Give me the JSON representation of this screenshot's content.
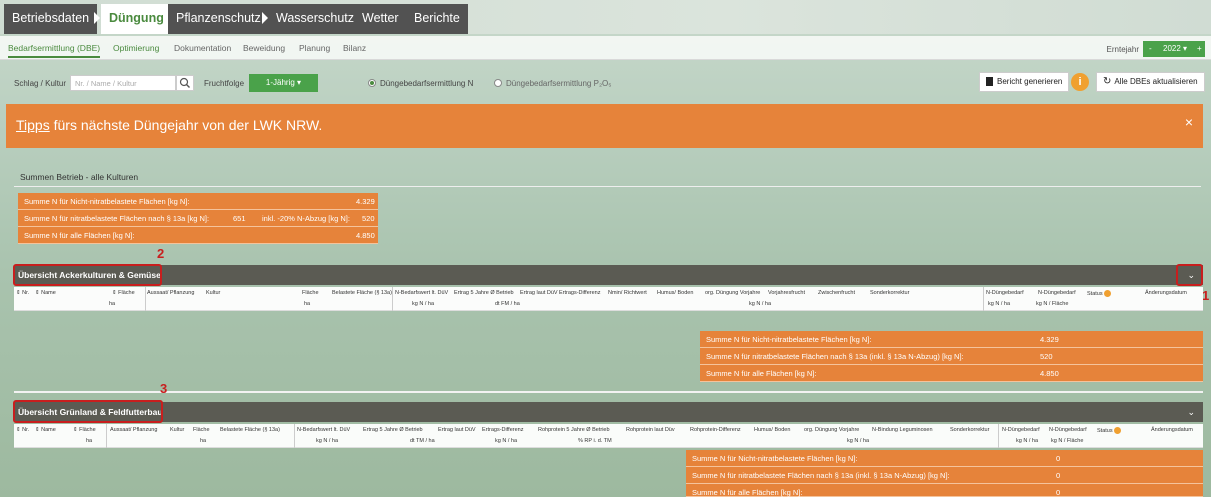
{
  "nav": {
    "tabs": [
      "Betriebsdaten",
      "Düngung",
      "Pflanzenschutz",
      "Wasserschutz",
      "Wetter",
      "Berichte"
    ],
    "active": "Düngung"
  },
  "subnav": {
    "tabs": [
      "Bedarfsermittlung (DBE)",
      "Optimierung",
      "Dokumentation",
      "Beweidung",
      "Planung",
      "Bilanz"
    ],
    "erntejahr_label": "Erntejahr",
    "year": "2022",
    "minus": "-",
    "plus": "+"
  },
  "toolbar": {
    "schlag_label": "Schlag / Kultur",
    "search_placeholder": "Nr. / Name / Kultur",
    "fruchtfolge_label": "Fruchtfolge",
    "fruchtfolge_value": "1-Jährig",
    "radio_n": "Düngebedarfsermittlung N",
    "radio_p": "Düngebedarfsermittlung P₂O₅",
    "report_btn": "Bericht generieren",
    "update_btn": "Alle DBEs aktualisieren",
    "info": "i"
  },
  "banner": {
    "link": "Tipps",
    "text": " fürs nächste Düngejahr von der LWK NRW.",
    "close": "×"
  },
  "summary": {
    "title": "Summen Betrieb - alle Kulturen",
    "row1_label": "Summe N für Nicht-nitratbelastete Flächen [kg N]:",
    "row1_value": "4.329",
    "row2_label": "Summe N für nitratbelastete Flächen nach § 13a [kg N]:",
    "row2_mid": "651",
    "row2_note": "inkl. -20% N-Abzug [kg N]:",
    "row2_value": "520",
    "row3_label": "Summe N für alle Flächen [kg N]:",
    "row3_value": "4.850"
  },
  "acker": {
    "title": "Übersicht Ackerkulturen & Gemüse",
    "chevron": "⌄",
    "cols": {
      "nr": "⇕ Nr.",
      "name": "⇕ Name",
      "flaeche": "⇕ Fläche",
      "aussaat": "Aussaat/ Pflanzung",
      "kultur": "Kultur",
      "flaeche2": "Fläche",
      "belastete": "Belastete Fläche (§ 13a)",
      "nbedarf": "N-Bedarfswert lt. DüV",
      "ertrag5": "Ertrag 5 Jahre Ø Betrieb",
      "ertraglaut": "Ertrag laut DüV",
      "ertragsdiff": "Ertrags-Differenz",
      "nmin": "Nmin/ Richtwert",
      "humus": "Humus/ Boden",
      "org": "org. Düngung Vorjahre",
      "vorjahr": "Vorjahresfrucht",
      "zwischen": "Zwischenfrucht",
      "sonder": "Sonderkorrektur",
      "nduenge1": "N-Düngebedarf",
      "nduenge2": "N-Düngebedarf",
      "status": "Status",
      "aenderung": "Änderungsdatum"
    },
    "units": {
      "ha1": "ha",
      "ha2": "ha",
      "kgn": "kg N / ha",
      "dtfm": "dt FM / ha",
      "kgn2": "kg N / ha",
      "kgn3": "kg N / ha",
      "kgfl": "kg N / Fläche"
    },
    "sum1_label": "Summe N für Nicht-nitratbelastete Flächen [kg N]:",
    "sum1_value": "4.329",
    "sum2_label": "Summe N für nitratbelastete Flächen nach § 13a (inkl. § 13a N-Abzug) [kg N]:",
    "sum2_value": "520",
    "sum3_label": "Summe N für alle Flächen [kg N]:",
    "sum3_value": "4.850"
  },
  "gruen": {
    "title": "Übersicht Grünland & Feldfutterbau",
    "chevron": "⌄",
    "cols": {
      "nr": "⇕ Nr.",
      "name": "⇕ Name",
      "flaeche": "⇕ Fläche",
      "aussaat": "Aussaat/ Pflanzung",
      "kultur": "Kultur",
      "flaeche2": "Fläche",
      "belastete": "Belastete Fläche (§ 13a)",
      "nbedarf": "N-Bedarfswert lt. DüV",
      "ertrag5": "Ertrag 5 Jahre Ø Betrieb",
      "ertraglaut": "Ertrag laut DüV",
      "ertragsdiff": "Ertrags-Differenz",
      "rohp5": "Rohprotein 5 Jahre Ø Betrieb",
      "rohplaut": "Rohprotein laut Düv",
      "rohpdiff": "Rohprotein-Differenz",
      "humus": "Humus/ Boden",
      "org": "org. Düngung Vorjahre",
      "nbindung": "N-Bindung Leguminosen",
      "sonder": "Sonderkorrektur",
      "nduenge1": "N-Düngebedarf",
      "nduenge2": "N-Düngebedarf",
      "status": "Status",
      "aenderung": "Änderungsdatum"
    },
    "units": {
      "ha1": "ha",
      "ha2": "ha",
      "kgn": "kg N / ha",
      "dttm": "dt TM / ha",
      "kgn2": "kg N / ha",
      "rp": "% RP i. d. TM",
      "kgn3": "kg N / ha",
      "kgn4": "kg N / ha",
      "kgfl": "kg N / Fläche"
    },
    "sum1_label": "Summe N für Nicht-nitratbelastete Flächen [kg N]:",
    "sum1_value": "0",
    "sum2_label": "Summe N für nitratbelastete Flächen nach § 13a (inkl. § 13a N-Abzug) [kg N]:",
    "sum2_value": "0",
    "sum3_label": "Summe N für alle Flächen [kg N]:",
    "sum3_value": "0"
  },
  "annotations": {
    "n1": "1",
    "n2": "2",
    "n3": "3"
  },
  "colors": {
    "accent_green": "#4aa24a",
    "orange": "#e6833a",
    "bar_dark": "#5b5b53",
    "annotation_red": "#c81e1e"
  }
}
